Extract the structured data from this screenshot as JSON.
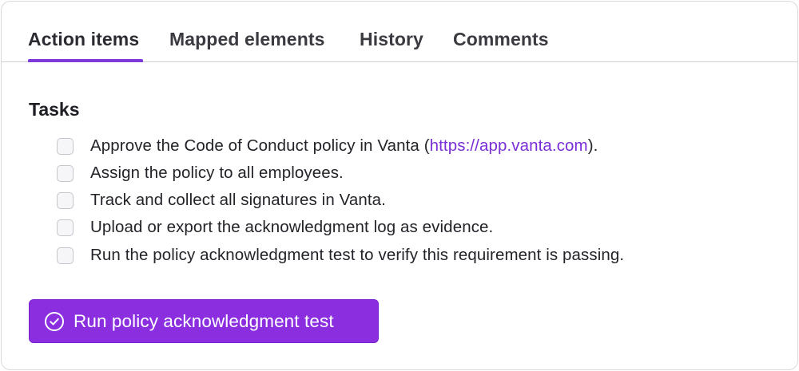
{
  "tabs": [
    {
      "label": "Action items",
      "active": true
    },
    {
      "label": "Mapped elements",
      "active": false
    },
    {
      "label": "History",
      "active": false
    },
    {
      "label": "Comments",
      "active": false
    }
  ],
  "tasks_section": {
    "title": "Tasks",
    "items": [
      {
        "text_before": "Approve the Code of Conduct policy in Vanta (",
        "link_text": "https://app.vanta.com",
        "text_after": ").",
        "checked": false
      },
      {
        "text": "Assign the policy to all employees.",
        "checked": false
      },
      {
        "text": "Track and collect all signatures in Vanta.",
        "checked": false
      },
      {
        "text": "Upload or export the acknowledgment log as evidence.",
        "checked": false
      },
      {
        "text": "Run the policy acknowledgment test to verify this requirement is passing.",
        "checked": false
      }
    ]
  },
  "run_button": {
    "label": "Run policy acknowledgment test",
    "icon": "check-circle-icon"
  },
  "colors": {
    "accent": "#8b2ee0",
    "link": "#7a2fd6",
    "tab_underline": "#7d3ad8"
  }
}
